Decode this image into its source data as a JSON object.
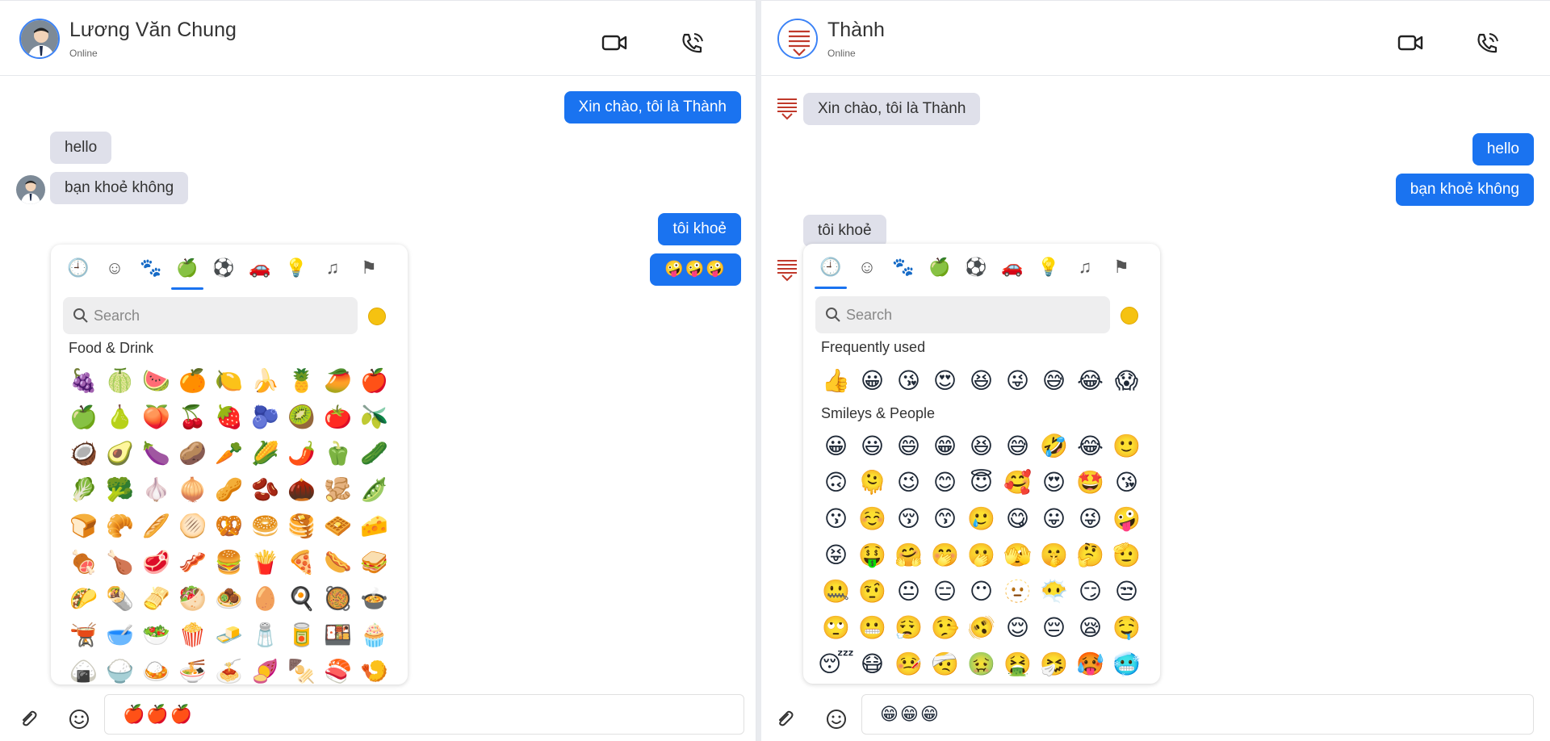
{
  "left": {
    "contact_name": "Lương Văn Chung",
    "status": "Online",
    "messages": [
      {
        "side": "out",
        "text": "Xin chào, tôi là Thành"
      },
      {
        "side": "in",
        "text": "hello"
      },
      {
        "side": "in",
        "text": "bạn khoẻ không"
      },
      {
        "side": "out",
        "text": "tôi khoẻ"
      },
      {
        "side": "out",
        "text": "🤪🤪🤪"
      }
    ],
    "picker": {
      "active_category": 3,
      "search_placeholder": "Search",
      "section_title": "Food & Drink",
      "emojis": [
        "🍇",
        "🍈",
        "🍉",
        "🍊",
        "🍋",
        "🍌",
        "🍍",
        "🥭",
        "🍎",
        "🍏",
        "🍐",
        "🍑",
        "🍒",
        "🍓",
        "🫐",
        "🥝",
        "🍅",
        "🫒",
        "🥥",
        "🥑",
        "🍆",
        "🥔",
        "🥕",
        "🌽",
        "🌶️",
        "🫑",
        "🥒",
        "🥬",
        "🥦",
        "🧄",
        "🧅",
        "🥜",
        "🫘",
        "🌰",
        "🫚",
        "🫛",
        "🍞",
        "🥐",
        "🥖",
        "🫓",
        "🥨",
        "🥯",
        "🥞",
        "🧇",
        "🧀",
        "🍖",
        "🍗",
        "🥩",
        "🥓",
        "🍔",
        "🍟",
        "🍕",
        "🌭",
        "🥪",
        "🌮",
        "🌯",
        "🫔",
        "🥙",
        "🧆",
        "🥚",
        "🍳",
        "🥘",
        "🍲",
        "🫕",
        "🥣",
        "🥗",
        "🍿",
        "🧈",
        "🧂",
        "🥫",
        "🍱",
        "🧁",
        "🍙",
        "🍚",
        "🍛",
        "🍜",
        "🍝",
        "🍠",
        "🍢",
        "🍣",
        "🍤"
      ]
    },
    "composer_text": "🍎🍎🍎"
  },
  "right": {
    "contact_name": "Thành",
    "status": "Online",
    "messages": [
      {
        "side": "in",
        "text": "Xin chào, tôi là Thành"
      },
      {
        "side": "out",
        "text": "hello"
      },
      {
        "side": "out",
        "text": "bạn khoẻ không"
      },
      {
        "side": "in",
        "text": "tôi khoẻ"
      }
    ],
    "picker": {
      "active_category": 0,
      "search_placeholder": "Search",
      "frequent_title": "Frequently used",
      "frequent": [
        "👍",
        "😀",
        "😘",
        "😍",
        "😆",
        "😜",
        "😅",
        "😂",
        "😱"
      ],
      "smileys_title": "Smileys & People",
      "smileys": [
        "😀",
        "😃",
        "😄",
        "😁",
        "😆",
        "😅",
        "🤣",
        "😂",
        "🙂",
        "🙃",
        "🫠",
        "😉",
        "😊",
        "😇",
        "🥰",
        "😍",
        "🤩",
        "😘",
        "😗",
        "☺️",
        "😚",
        "😙",
        "🥲",
        "😋",
        "😛",
        "😜",
        "🤪",
        "😝",
        "🤑",
        "🤗",
        "🤭",
        "🫢",
        "🫣",
        "🤫",
        "🤔",
        "🫡",
        "🤐",
        "🤨",
        "😐",
        "😑",
        "😶",
        "🫥",
        "😶‍🌫️",
        "😏",
        "😒",
        "🙄",
        "😬",
        "😮‍💨",
        "🤥",
        "🫨",
        "😌",
        "😔",
        "😪",
        "🤤",
        "😴",
        "😷",
        "🤒",
        "🤕",
        "🤢",
        "🤮",
        "🤧",
        "🥵",
        "🥶"
      ]
    },
    "composer_text": "😁😁😁"
  },
  "picker_categories": [
    "clock-icon",
    "smiley-icon",
    "animal-icon",
    "food-icon",
    "ball-icon",
    "car-icon",
    "bulb-icon",
    "symbols-icon",
    "flag-icon"
  ]
}
